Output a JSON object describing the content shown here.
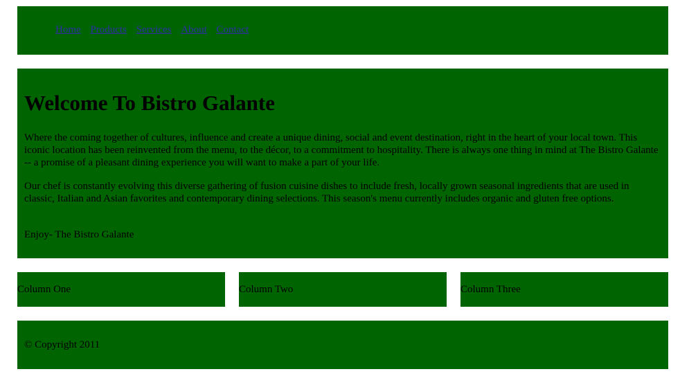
{
  "nav": {
    "items": [
      {
        "label": "Home"
      },
      {
        "label": "Products"
      },
      {
        "label": "Services"
      },
      {
        "label": "About"
      },
      {
        "label": "Contact"
      }
    ]
  },
  "main": {
    "title": "Welcome To Bistro Galante",
    "paragraphs": [
      "Where the coming together of cultures, influence and create a unique dining, social and event destination, right in the heart of your local town. This iconic location has been reinvented from the menu, to the décor, to a commitment to hospitality. There is always one thing in mind at The Bistro Galante -- a promise of a pleasant dining experience you will want to make a part of your life.",
      "Our chef is constantly evolving this diverse gathering of fusion cuisine dishes to include fresh, locally grown seasonal ingredients that are used in classic, Italian and Asian favorites and contemporary dining selections. This season's menu currently includes organic and gluten free options.",
      "Enjoy- The Bistro Galante"
    ]
  },
  "columns": [
    {
      "label": "Column One"
    },
    {
      "label": "Column Two"
    },
    {
      "label": "Column Three"
    }
  ],
  "footer": {
    "copyright": "© Copyright 2011"
  },
  "colors": {
    "panel_background": "#006400",
    "page_background": "#ffffff",
    "link": "#2c2ca8"
  }
}
